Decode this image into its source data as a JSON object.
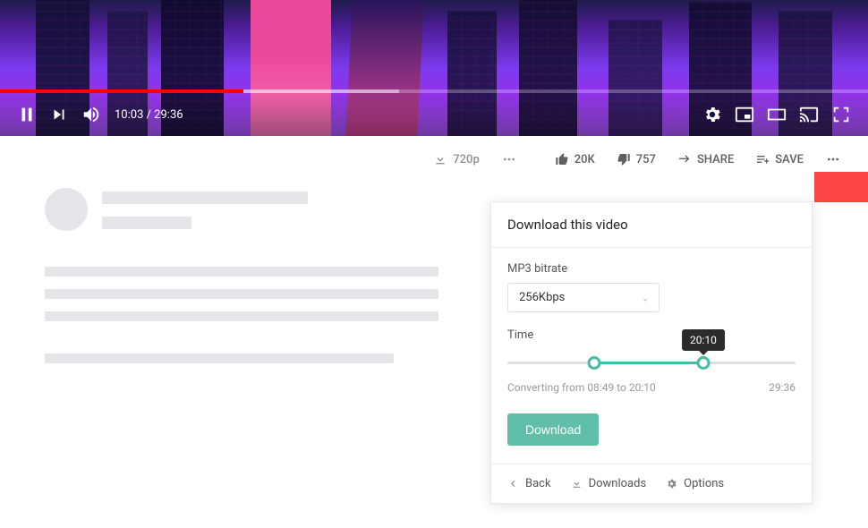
{
  "player": {
    "current_time": "10:03",
    "duration": "29:36",
    "time_display": "10:03 / 29:36",
    "progress_played_pct": 28,
    "progress_buffered_pct": 46
  },
  "actions": {
    "quality_label": "720p",
    "likes": "20K",
    "dislikes": "757",
    "share_label": "SHARE",
    "save_label": "SAVE"
  },
  "download_panel": {
    "title": "Download this video",
    "bitrate_label": "MP3 bitrate",
    "bitrate_value": "256Kbps",
    "time_label": "Time",
    "slider_start_pct": 30,
    "slider_end_pct": 68,
    "tooltip_value": "20:10",
    "converting_text": "Converting from 08:49 to 20:10",
    "total_time": "29:36",
    "download_button": "Download",
    "footer": {
      "back": "Back",
      "downloads": "Downloads",
      "options": "Options"
    }
  }
}
